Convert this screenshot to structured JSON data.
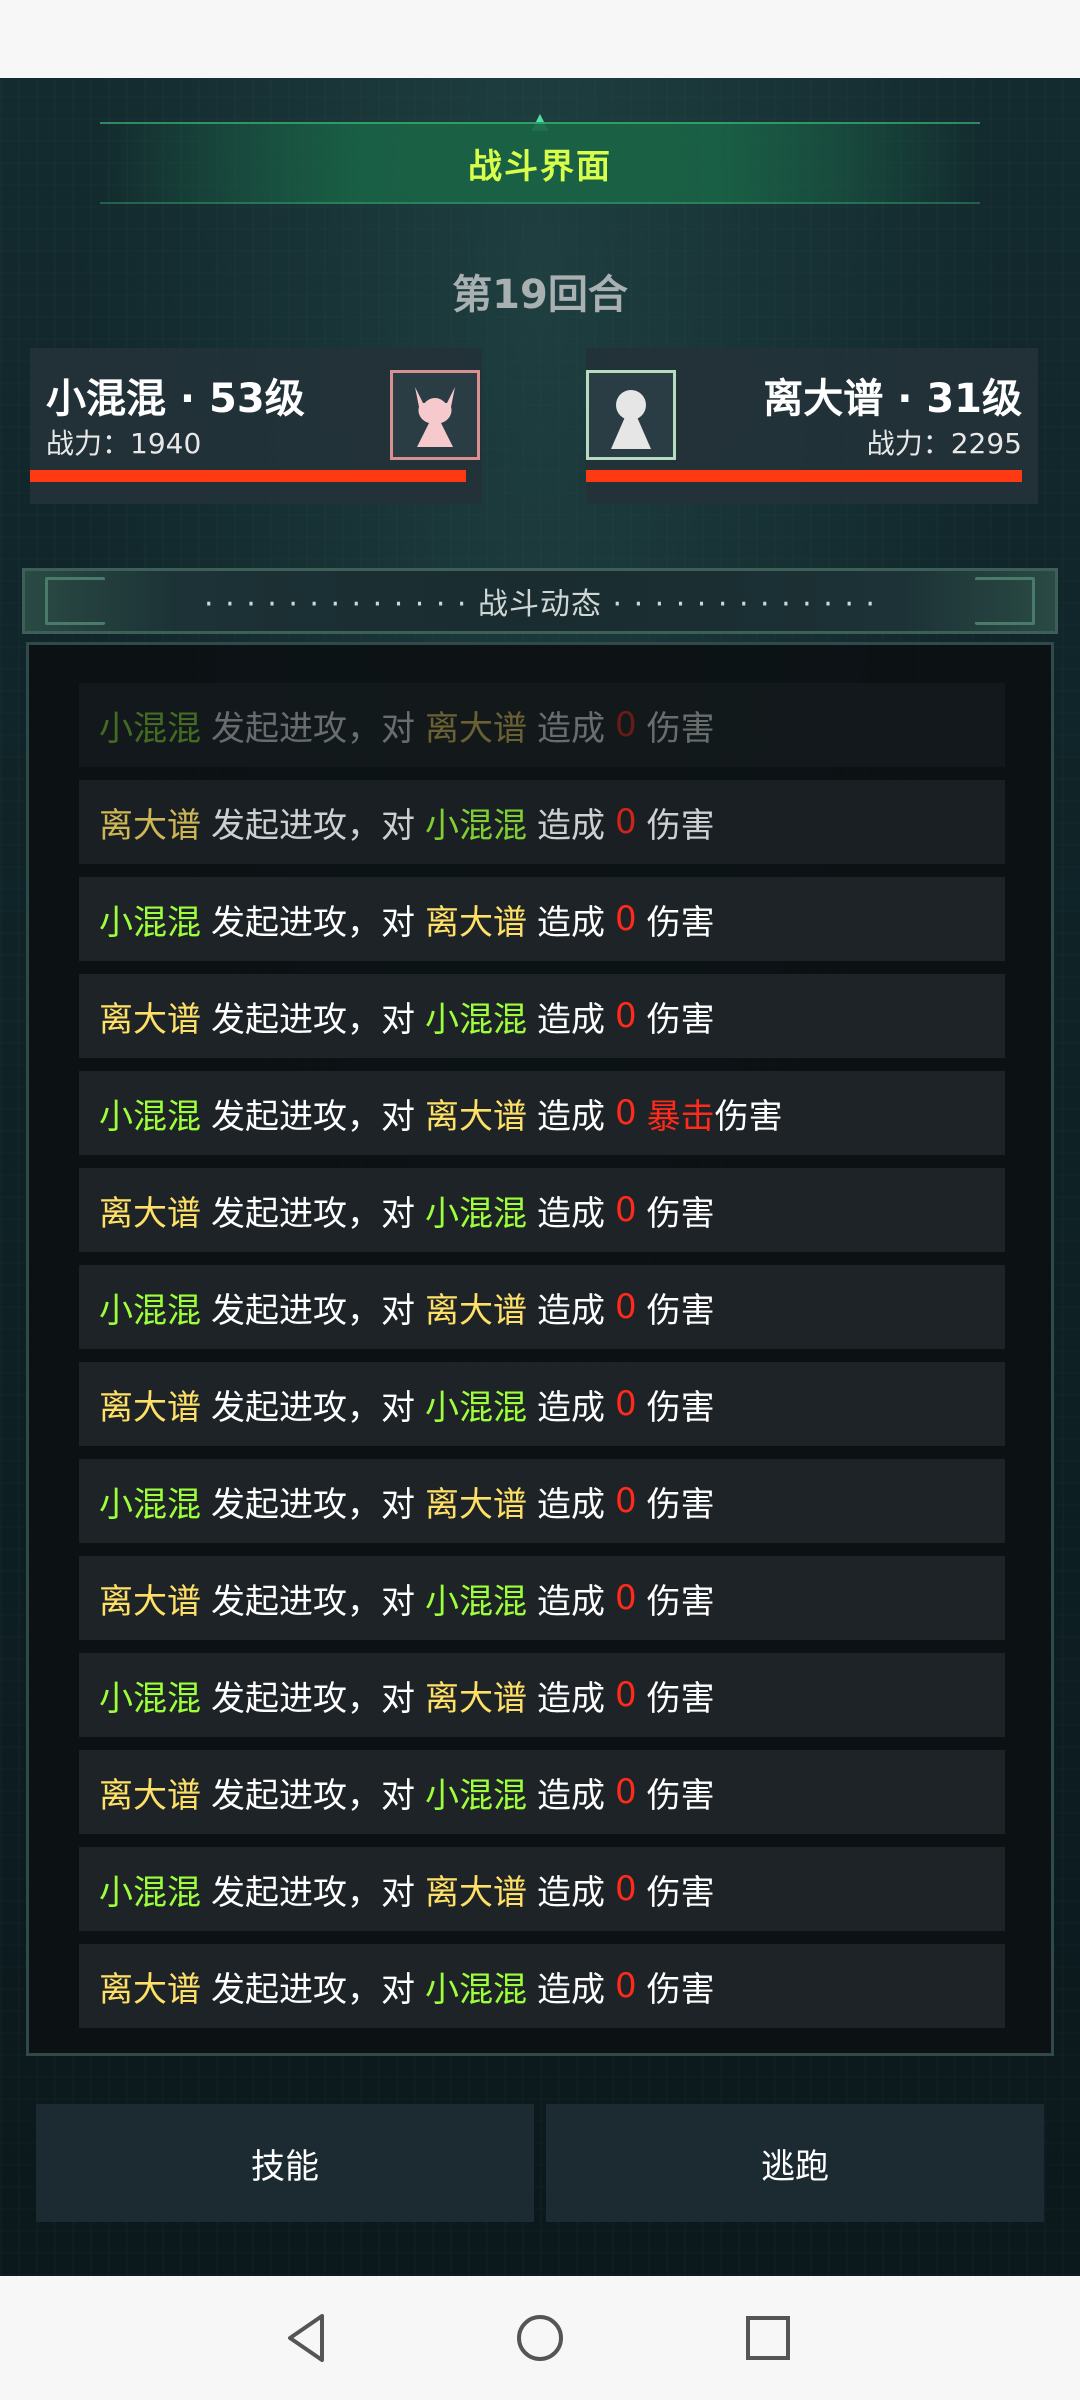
{
  "screen": {
    "title": "战斗界面",
    "round": "第19回合"
  },
  "player": {
    "name": "小混混 · 53级",
    "power": "战力：1940",
    "hp_fraction": 1.0,
    "avatar_icon": "horned-figure-icon",
    "color": "#9dff3a"
  },
  "enemy": {
    "name": "离大谱 · 31级",
    "power": "战力：2295",
    "hp_fraction": 1.0,
    "avatar_icon": "person-silhouette-icon",
    "color": "#ffe066"
  },
  "log": {
    "header": "· · · · · · · · · · · · · 战斗动态 · · · · · · · · · · · · ·",
    "entries": [
      {
        "attacker": "小混混",
        "mid1": "发起进攻，对",
        "target": "离大谱",
        "mid2": "造成",
        "damage": "0",
        "crit": "",
        "suffix": "伤害"
      },
      {
        "attacker": "离大谱",
        "mid1": "发起进攻，对",
        "target": "小混混",
        "mid2": "造成",
        "damage": "0",
        "crit": "",
        "suffix": "伤害"
      },
      {
        "attacker": "小混混",
        "mid1": "发起进攻，对",
        "target": "离大谱",
        "mid2": "造成",
        "damage": "0",
        "crit": "",
        "suffix": "伤害"
      },
      {
        "attacker": "离大谱",
        "mid1": "发起进攻，对",
        "target": "小混混",
        "mid2": "造成",
        "damage": "0",
        "crit": "",
        "suffix": "伤害"
      },
      {
        "attacker": "小混混",
        "mid1": "发起进攻，对",
        "target": "离大谱",
        "mid2": "造成",
        "damage": "0",
        "crit": "暴击",
        "suffix": "伤害"
      },
      {
        "attacker": "离大谱",
        "mid1": "发起进攻，对",
        "target": "小混混",
        "mid2": "造成",
        "damage": "0",
        "crit": "",
        "suffix": "伤害"
      },
      {
        "attacker": "小混混",
        "mid1": "发起进攻，对",
        "target": "离大谱",
        "mid2": "造成",
        "damage": "0",
        "crit": "",
        "suffix": "伤害"
      },
      {
        "attacker": "离大谱",
        "mid1": "发起进攻，对",
        "target": "小混混",
        "mid2": "造成",
        "damage": "0",
        "crit": "",
        "suffix": "伤害"
      },
      {
        "attacker": "小混混",
        "mid1": "发起进攻，对",
        "target": "离大谱",
        "mid2": "造成",
        "damage": "0",
        "crit": "",
        "suffix": "伤害"
      },
      {
        "attacker": "离大谱",
        "mid1": "发起进攻，对",
        "target": "小混混",
        "mid2": "造成",
        "damage": "0",
        "crit": "",
        "suffix": "伤害"
      },
      {
        "attacker": "小混混",
        "mid1": "发起进攻，对",
        "target": "离大谱",
        "mid2": "造成",
        "damage": "0",
        "crit": "",
        "suffix": "伤害"
      },
      {
        "attacker": "离大谱",
        "mid1": "发起进攻，对",
        "target": "小混混",
        "mid2": "造成",
        "damage": "0",
        "crit": "",
        "suffix": "伤害"
      },
      {
        "attacker": "小混混",
        "mid1": "发起进攻，对",
        "target": "离大谱",
        "mid2": "造成",
        "damage": "0",
        "crit": "",
        "suffix": "伤害"
      },
      {
        "attacker": "离大谱",
        "mid1": "发起进攻，对",
        "target": "小混混",
        "mid2": "造成",
        "damage": "0",
        "crit": "",
        "suffix": "伤害"
      }
    ]
  },
  "actions": {
    "skill": "技能",
    "flee": "逃跑"
  },
  "navbar": {
    "back_icon": "back-triangle-icon",
    "home_icon": "home-circle-icon",
    "recent_icon": "recent-square-icon"
  }
}
